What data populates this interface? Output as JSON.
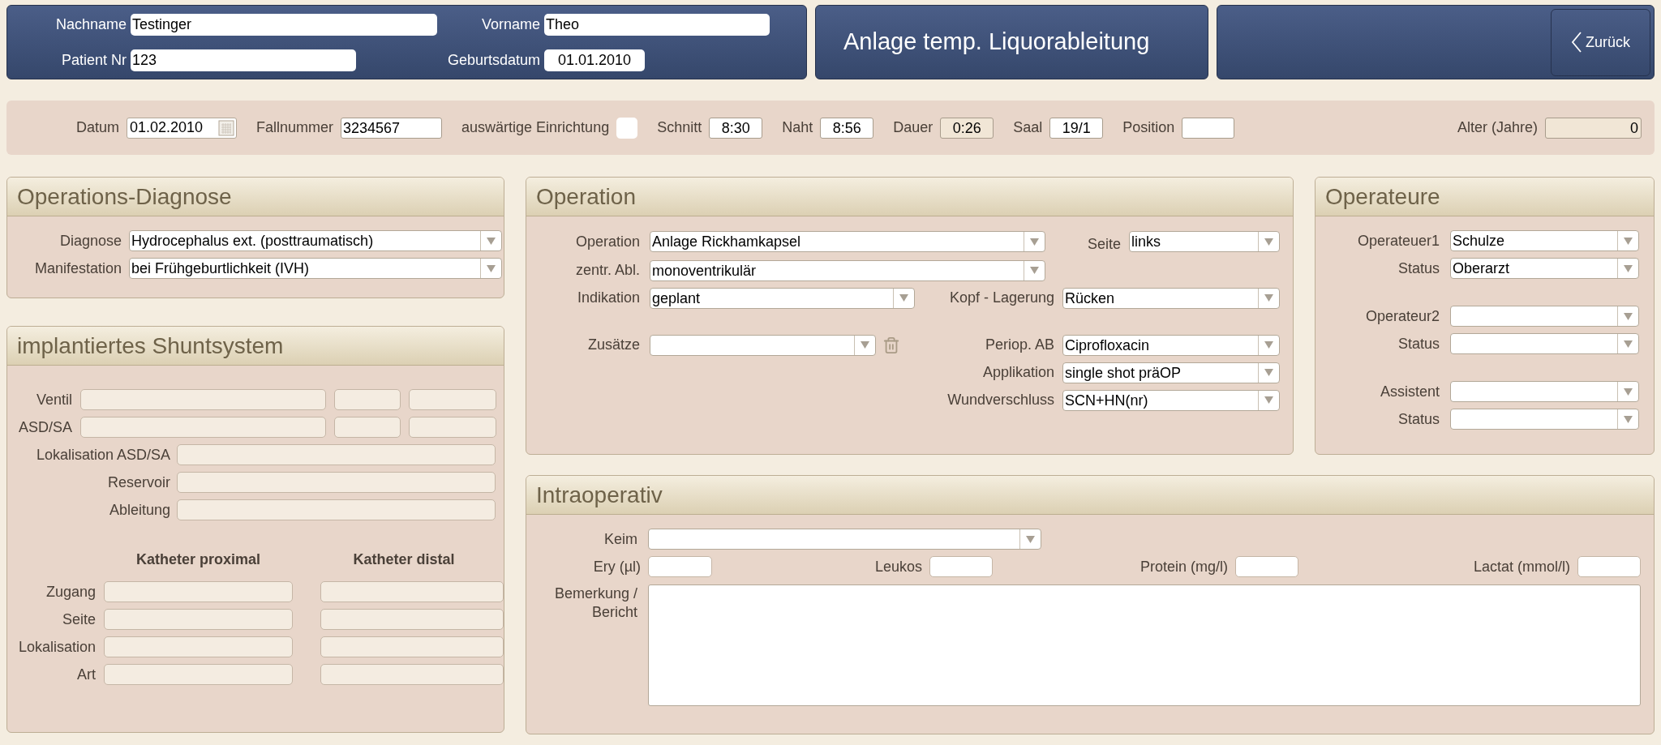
{
  "header": {
    "fields": [
      {
        "label": "Nachname",
        "value": "Testinger"
      },
      {
        "label": "Vorname",
        "value": "Theo"
      },
      {
        "label": "Patient Nr",
        "value": "123"
      },
      {
        "label": "Geburtsdatum",
        "value": "01.01.2010"
      }
    ],
    "title": "Anlage temp. Liquorableitung",
    "back_button": "Zurück"
  },
  "case_bar": {
    "fields": [
      {
        "kind": "date",
        "label": "Datum",
        "value": "01.02.2010"
      },
      {
        "kind": "text",
        "label": "Fallnummer",
        "value": "3234567"
      },
      {
        "kind": "checkbox",
        "label": "auswärtige Einrichtung",
        "checked": false
      },
      {
        "kind": "text",
        "label": "Schnitt",
        "value": "8:30"
      },
      {
        "kind": "text",
        "label": "Naht",
        "value": "8:56"
      },
      {
        "kind": "readonly",
        "label": "Dauer",
        "value": "0:26"
      },
      {
        "kind": "text",
        "label": "Saal",
        "value": "19/1"
      },
      {
        "kind": "text",
        "label": "Position"
      },
      {
        "kind": "readonly",
        "label": "Alter (Jahre)",
        "value": "0"
      }
    ]
  },
  "diagnosis": {
    "title": "Operations-Diagnose",
    "fields": [
      {
        "label": "Diagnose",
        "value": "Hydrocephalus ext. (posttraumatisch)"
      },
      {
        "label": "Manifestation",
        "value": "bei Frühgeburtlichkeit (IVH)"
      }
    ]
  },
  "shunt": {
    "title": "implantiertes Shuntsystem",
    "split_rows": [
      "Ventil",
      "ASD/SA"
    ],
    "wide_rows": [
      "Lokalisation ASD/SA",
      "Reservoir",
      "Ableitung"
    ],
    "catheter": {
      "columns": [
        "Katheter proximal",
        "Katheter distal"
      ],
      "rows": [
        "Zugang",
        "Seite",
        "Lokalisation",
        "Art"
      ]
    }
  },
  "operation": {
    "title": "Operation",
    "fields": [
      {
        "label": "Operation",
        "value": "Anlage Rickhamkapsel"
      },
      {
        "label": "Seite",
        "value": "links"
      },
      {
        "label": "zentr. Abl.",
        "value": "monoventrikulär"
      },
      {
        "label": "Indikation",
        "value": "geplant"
      },
      {
        "label": "Kopf - Lagerung",
        "value": "Rücken"
      },
      {
        "label": "Zusätze"
      },
      {
        "label": "Periop. AB",
        "value": "Ciprofloxacin"
      },
      {
        "label": "Applikation",
        "value": "single shot präOP"
      },
      {
        "label": "Wundverschluss",
        "value": "SCN+HN(nr)"
      }
    ]
  },
  "surgeons": {
    "title": "Operateure",
    "groups": [
      [
        {
          "label": "Operateuer1",
          "value": "Schulze"
        },
        {
          "label": "Status",
          "value": "Oberarzt"
        }
      ],
      [
        {
          "label": "Operateur2"
        },
        {
          "label": "Status"
        }
      ],
      [
        {
          "label": "Assistent"
        },
        {
          "label": "Status"
        }
      ]
    ]
  },
  "intraop": {
    "title": "Intraoperativ",
    "keim": {
      "label": "Keim"
    },
    "lab_fields": [
      {
        "label": "Ery (µl)"
      },
      {
        "label": "Leukos"
      },
      {
        "label": "Protein (mg/l)"
      },
      {
        "label": "Lactat (mmol/l)"
      }
    ],
    "remarks": {
      "label": "Bemerkung / Bericht"
    }
  }
}
